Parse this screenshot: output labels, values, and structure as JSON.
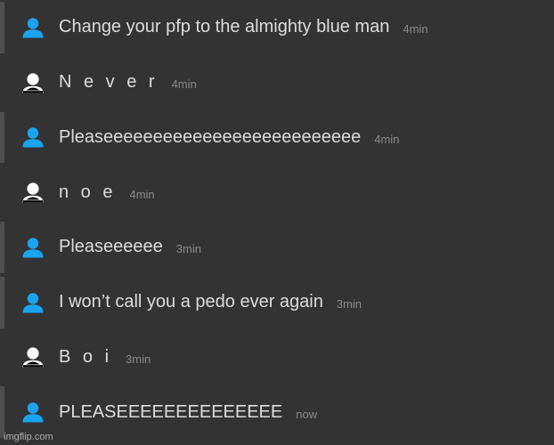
{
  "messages": [
    {
      "sender": "blue",
      "text": "Change your pfp to the almighty blue man",
      "time": "4min",
      "spaced": false
    },
    {
      "sender": "white",
      "text": "N e v e r",
      "time": "4min",
      "spaced": false
    },
    {
      "sender": "blue",
      "text": "Pleaseeeeeeeeeeeeeeeeeeeeeeeeee",
      "time": "4min",
      "spaced": false
    },
    {
      "sender": "white",
      "text": "n o e",
      "time": "4min",
      "spaced": false
    },
    {
      "sender": "blue",
      "text": "Pleaseeeeee",
      "time": "3min",
      "spaced": false
    },
    {
      "sender": "blue",
      "text": "I won’t call you a pedo ever again",
      "time": "3min",
      "spaced": false
    },
    {
      "sender": "white",
      "text": "B o i",
      "time": "3min",
      "spaced": false
    },
    {
      "sender": "blue",
      "text": "PLEASEEEEEEEEEEEEEE",
      "time": "now",
      "spaced": false
    }
  ],
  "watermark": "imgflip.com",
  "colors": {
    "background": "#333333",
    "blue_avatar": "#1aa3f0",
    "white_avatar": "#ffffff",
    "text": "#dcdcdc",
    "time": "#8a8a8a"
  },
  "icons": {
    "blue": "person-icon-blue",
    "white": "person-icon-white"
  }
}
